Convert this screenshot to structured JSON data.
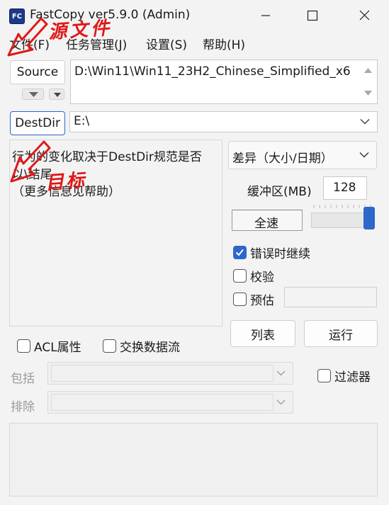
{
  "window": {
    "app_icon_text": "FC",
    "title": "FastCopy ver5.9.0 (Admin)"
  },
  "menu": [
    "文件(F)",
    "任务管理(J)",
    "设置(S)",
    "帮助(H)"
  ],
  "source": {
    "button_label": "Source",
    "path": "D:\\Win11\\Win11_23H2_Chinese_Simplified_x6"
  },
  "dest": {
    "button_label": "DestDir",
    "path": "E:\\"
  },
  "info_text": {
    "line1": "行为的变化取决于DestDir规范是否",
    "line2": "以\\结尾",
    "line3": "（更多信息见帮助）"
  },
  "mode": {
    "selected": "差异（大小/日期）"
  },
  "buffer": {
    "label": "缓冲区(MB)",
    "value": "128"
  },
  "speed": {
    "label": "全速",
    "level": 1.0
  },
  "options": {
    "continue_on_error": {
      "label": "错误时继续",
      "checked": true
    },
    "verify": {
      "label": "校验",
      "checked": false
    },
    "estimate": {
      "label": "预估",
      "checked": false
    }
  },
  "actions": {
    "list_label": "列表",
    "run_label": "运行"
  },
  "attrs": {
    "acl": {
      "label": "ACL属性",
      "checked": false
    },
    "streams": {
      "label": "交换数据流",
      "checked": false
    }
  },
  "filters": {
    "include_label": "包括",
    "exclude_label": "排除",
    "filter_label": "过滤器",
    "filter_checked": false
  },
  "annotations": {
    "source_note": "源文件",
    "dest_note": "目标"
  },
  "colors": {
    "accent": "#2c67c9",
    "annotation": "#e01818"
  }
}
